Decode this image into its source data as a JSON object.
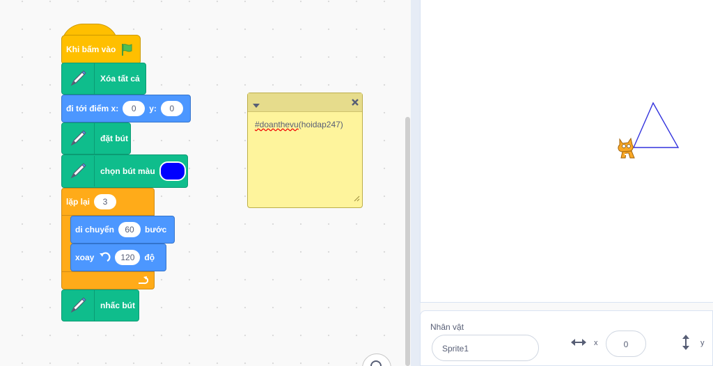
{
  "script": {
    "when_flag_clicked": "Khi bấm vào",
    "clear_all": "Xóa tất cả",
    "goto": {
      "label": "đi tới điểm x:",
      "x": "0",
      "ylabel": "y:",
      "y": "0"
    },
    "pen_down": "đặt bút",
    "set_pen_color": {
      "label": "chọn bút màu",
      "color": "#0000ff"
    },
    "repeat": {
      "label": "lặp lại",
      "times": "3"
    },
    "move": {
      "label": "di chuyển",
      "steps": "60",
      "unit": "bước"
    },
    "turn": {
      "label": "xoay",
      "degrees": "120",
      "unit": "độ"
    },
    "pen_up": "nhấc bút"
  },
  "comment": {
    "text_underlined": "#doanthevu",
    "text_rest": "(hoidap247)"
  },
  "sprite_info": {
    "label": "Nhân vật",
    "name": "Sprite1",
    "x_label": "x",
    "x": "0",
    "y_label": "y"
  },
  "colors": {
    "events": "#ffbf00",
    "pen": "#0fbd8c",
    "motion": "#4c97ff",
    "control": "#ffab19",
    "triangle": "#3333dd"
  },
  "icons": [
    "green-flag-icon",
    "pen-icon",
    "turn-left-icon",
    "loop-arrow-icon",
    "collapse-triangle-icon",
    "close-icon",
    "resize-grip-icon",
    "arrows-horizontal-icon",
    "arrows-vertical-icon",
    "zoom-icon",
    "scratch-cat-sprite"
  ]
}
